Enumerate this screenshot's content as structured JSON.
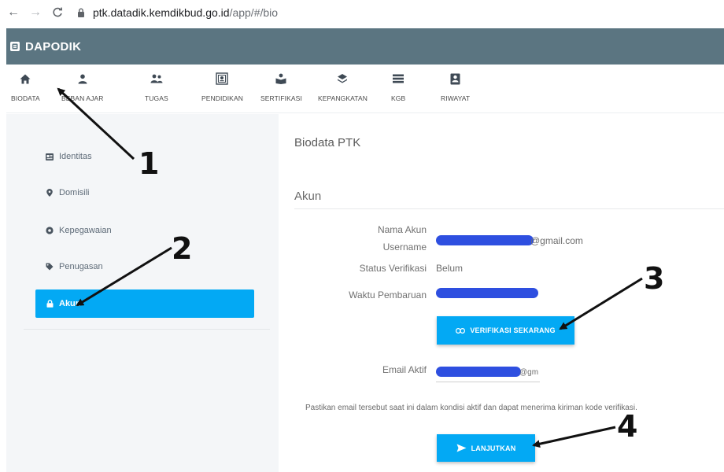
{
  "browser": {
    "back_icon": "arrow-left-icon",
    "forward_icon": "arrow-right-icon",
    "reload_icon": "reload-icon",
    "lock_icon": "lock-icon",
    "url_host": "ptk.datadik.kemdikbud.go.id",
    "url_path": "/app/#/bio"
  },
  "app": {
    "title": "DAPODIK",
    "header_color": "#5b7581",
    "accent_color": "#03a9f4"
  },
  "menu": {
    "items": [
      {
        "label": "BIODATA",
        "icon": "home-icon"
      },
      {
        "label": "BEBAN AJAR",
        "icon": "person-icon"
      },
      {
        "label": "TUGAS",
        "icon": "group-icon"
      },
      {
        "label": "PENDIDIKAN",
        "icon": "certificate-icon"
      },
      {
        "label": "SERTIFIKASI",
        "icon": "award-icon"
      },
      {
        "label": "KEPANGKATAN",
        "icon": "layers-icon"
      },
      {
        "label": "KGB",
        "icon": "list-icon"
      },
      {
        "label": "RIWAYAT",
        "icon": "badge-icon"
      }
    ]
  },
  "sidebar": {
    "items": [
      {
        "label": "Identitas",
        "icon": "id-card-icon"
      },
      {
        "label": "Domisili",
        "icon": "map-pin-icon"
      },
      {
        "label": "Kepegawaian",
        "icon": "gear-icon"
      },
      {
        "label": "Penugasan",
        "icon": "tag-icon"
      },
      {
        "label": "Akun",
        "icon": "lock-icon",
        "active": true
      }
    ]
  },
  "main": {
    "page_title": "Biodata PTK",
    "section_title": "Akun",
    "fields": {
      "account_name_label": "Nama Akun",
      "username_label": "Username",
      "username_value_suffix": "@gmail.com",
      "status_label": "Status Verifikasi",
      "status_value": "Belum",
      "updated_label": "Waktu Pembaruan",
      "email_label": "Email Aktif",
      "email_value_suffix": "@gm"
    },
    "verify_button": "VERIFIKASI SEKARANG",
    "verify_icon": "link-icon",
    "note": "Pastikan email tersebut saat ini dalam kondisi aktif dan dapat menerima kiriman kode verifikasi.",
    "continue_button": "LANJUTKAN",
    "continue_icon": "send-icon"
  },
  "annotations": {
    "labels": [
      "1",
      "2",
      "3",
      "4"
    ]
  }
}
